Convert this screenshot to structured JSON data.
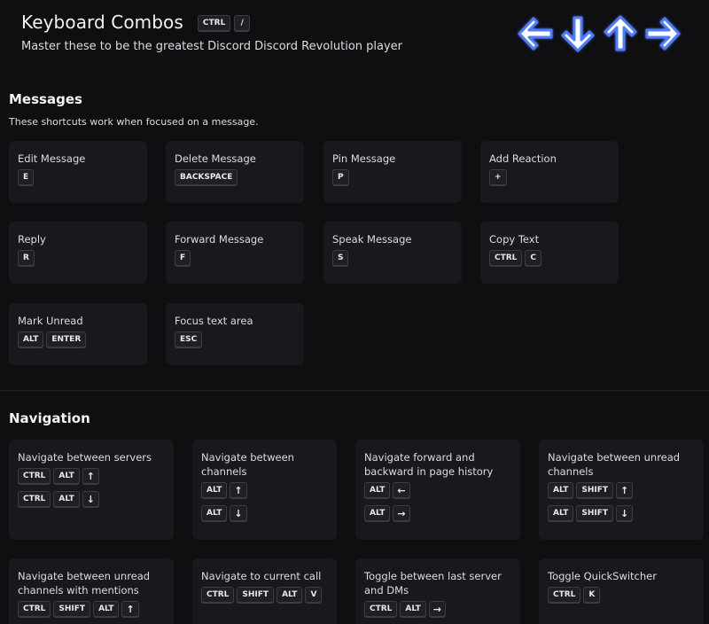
{
  "header": {
    "title": "Keyboard Combos",
    "title_keys": [
      "CTRL",
      "/"
    ],
    "subtitle": "Master these to be the greatest Discord Discord Revolution player",
    "arrow_icons": [
      "arrow-left-icon",
      "arrow-down-icon",
      "arrow-up-icon",
      "arrow-right-icon"
    ]
  },
  "messages": {
    "title": "Messages",
    "description": "These shortcuts work when focused on a message.",
    "items": [
      {
        "label": "Edit Message",
        "combos": [
          [
            "E"
          ]
        ]
      },
      {
        "label": "Delete Message",
        "combos": [
          [
            "BACKSPACE"
          ]
        ]
      },
      {
        "label": "Pin Message",
        "combos": [
          [
            "P"
          ]
        ]
      },
      {
        "label": "Add Reaction",
        "combos": [
          [
            "+"
          ]
        ]
      },
      {
        "label": "Reply",
        "combos": [
          [
            "R"
          ]
        ]
      },
      {
        "label": "Forward Message",
        "combos": [
          [
            "F"
          ]
        ]
      },
      {
        "label": "Speak Message",
        "combos": [
          [
            "S"
          ]
        ]
      },
      {
        "label": "Copy Text",
        "combos": [
          [
            "CTRL",
            "C"
          ]
        ]
      },
      {
        "label": "Mark Unread",
        "combos": [
          [
            "ALT",
            "ENTER"
          ]
        ]
      },
      {
        "label": "Focus text area",
        "combos": [
          [
            "ESC"
          ]
        ]
      }
    ]
  },
  "navigation": {
    "title": "Navigation",
    "items": [
      {
        "label": "Navigate between servers",
        "combos": [
          [
            "CTRL",
            "ALT",
            "↑"
          ],
          [
            "CTRL",
            "ALT",
            "↓"
          ]
        ]
      },
      {
        "label": "Navigate between channels",
        "combos": [
          [
            "ALT",
            "↑"
          ],
          [
            "ALT",
            "↓"
          ]
        ]
      },
      {
        "label": "Navigate forward and backward in page history",
        "combos": [
          [
            "ALT",
            "←"
          ],
          [
            "ALT",
            "→"
          ]
        ]
      },
      {
        "label": "Navigate between unread channels",
        "combos": [
          [
            "ALT",
            "SHIFT",
            "↑"
          ],
          [
            "ALT",
            "SHIFT",
            "↓"
          ]
        ]
      },
      {
        "label": "Navigate between unread channels with mentions",
        "combos": [
          [
            "CTRL",
            "SHIFT",
            "ALT",
            "↑"
          ]
        ]
      },
      {
        "label": "Navigate to current call",
        "combos": [
          [
            "CTRL",
            "SHIFT",
            "ALT",
            "V"
          ]
        ]
      },
      {
        "label": "Toggle between last server and DMs",
        "combos": [
          [
            "CTRL",
            "ALT",
            "→"
          ]
        ]
      },
      {
        "label": "Toggle QuickSwitcher",
        "combos": [
          [
            "CTRL",
            "K"
          ]
        ]
      }
    ]
  },
  "colors": {
    "background": "#0f0f12",
    "card": "#18191c",
    "arrow_fill": "#ffffff",
    "arrow_glow": "#4f7bff"
  }
}
